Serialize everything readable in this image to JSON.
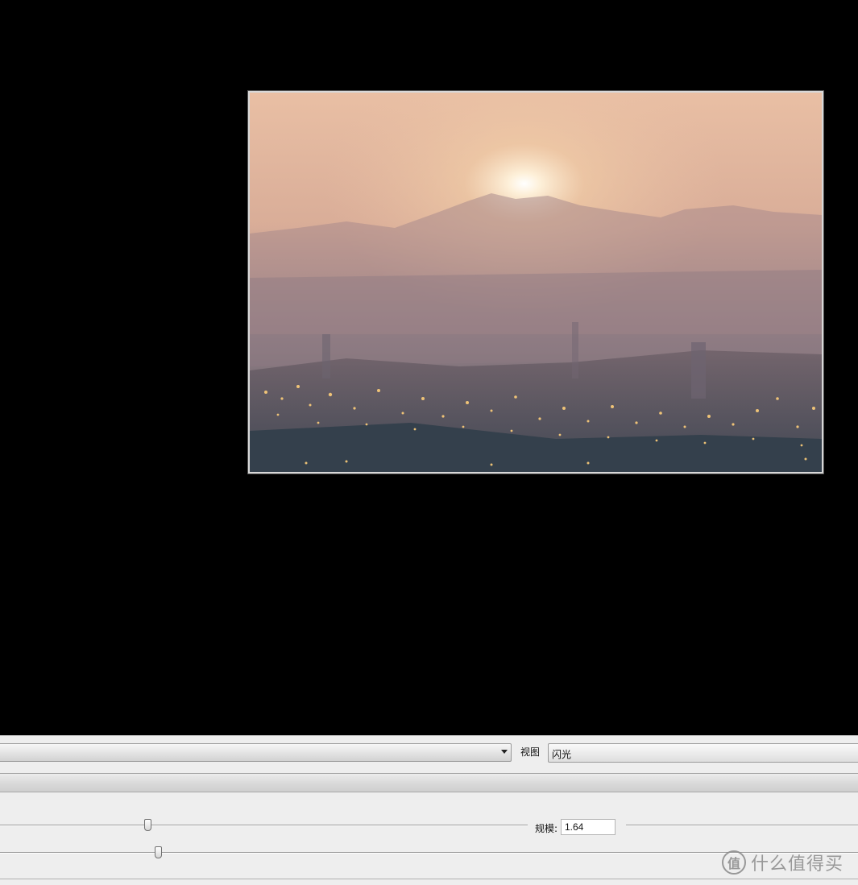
{
  "preview": {
    "image_alt": "Hazy sunset over city lights"
  },
  "controls": {
    "preset_value": "",
    "view_label": "视图",
    "view_value": "闪光",
    "scale_label": "规模:",
    "scale_value": "1.64",
    "slider_1_value": 0.28,
    "slider_2_value": 0.18
  },
  "watermark": {
    "logo_glyph": "值",
    "text": "什么值得买"
  }
}
